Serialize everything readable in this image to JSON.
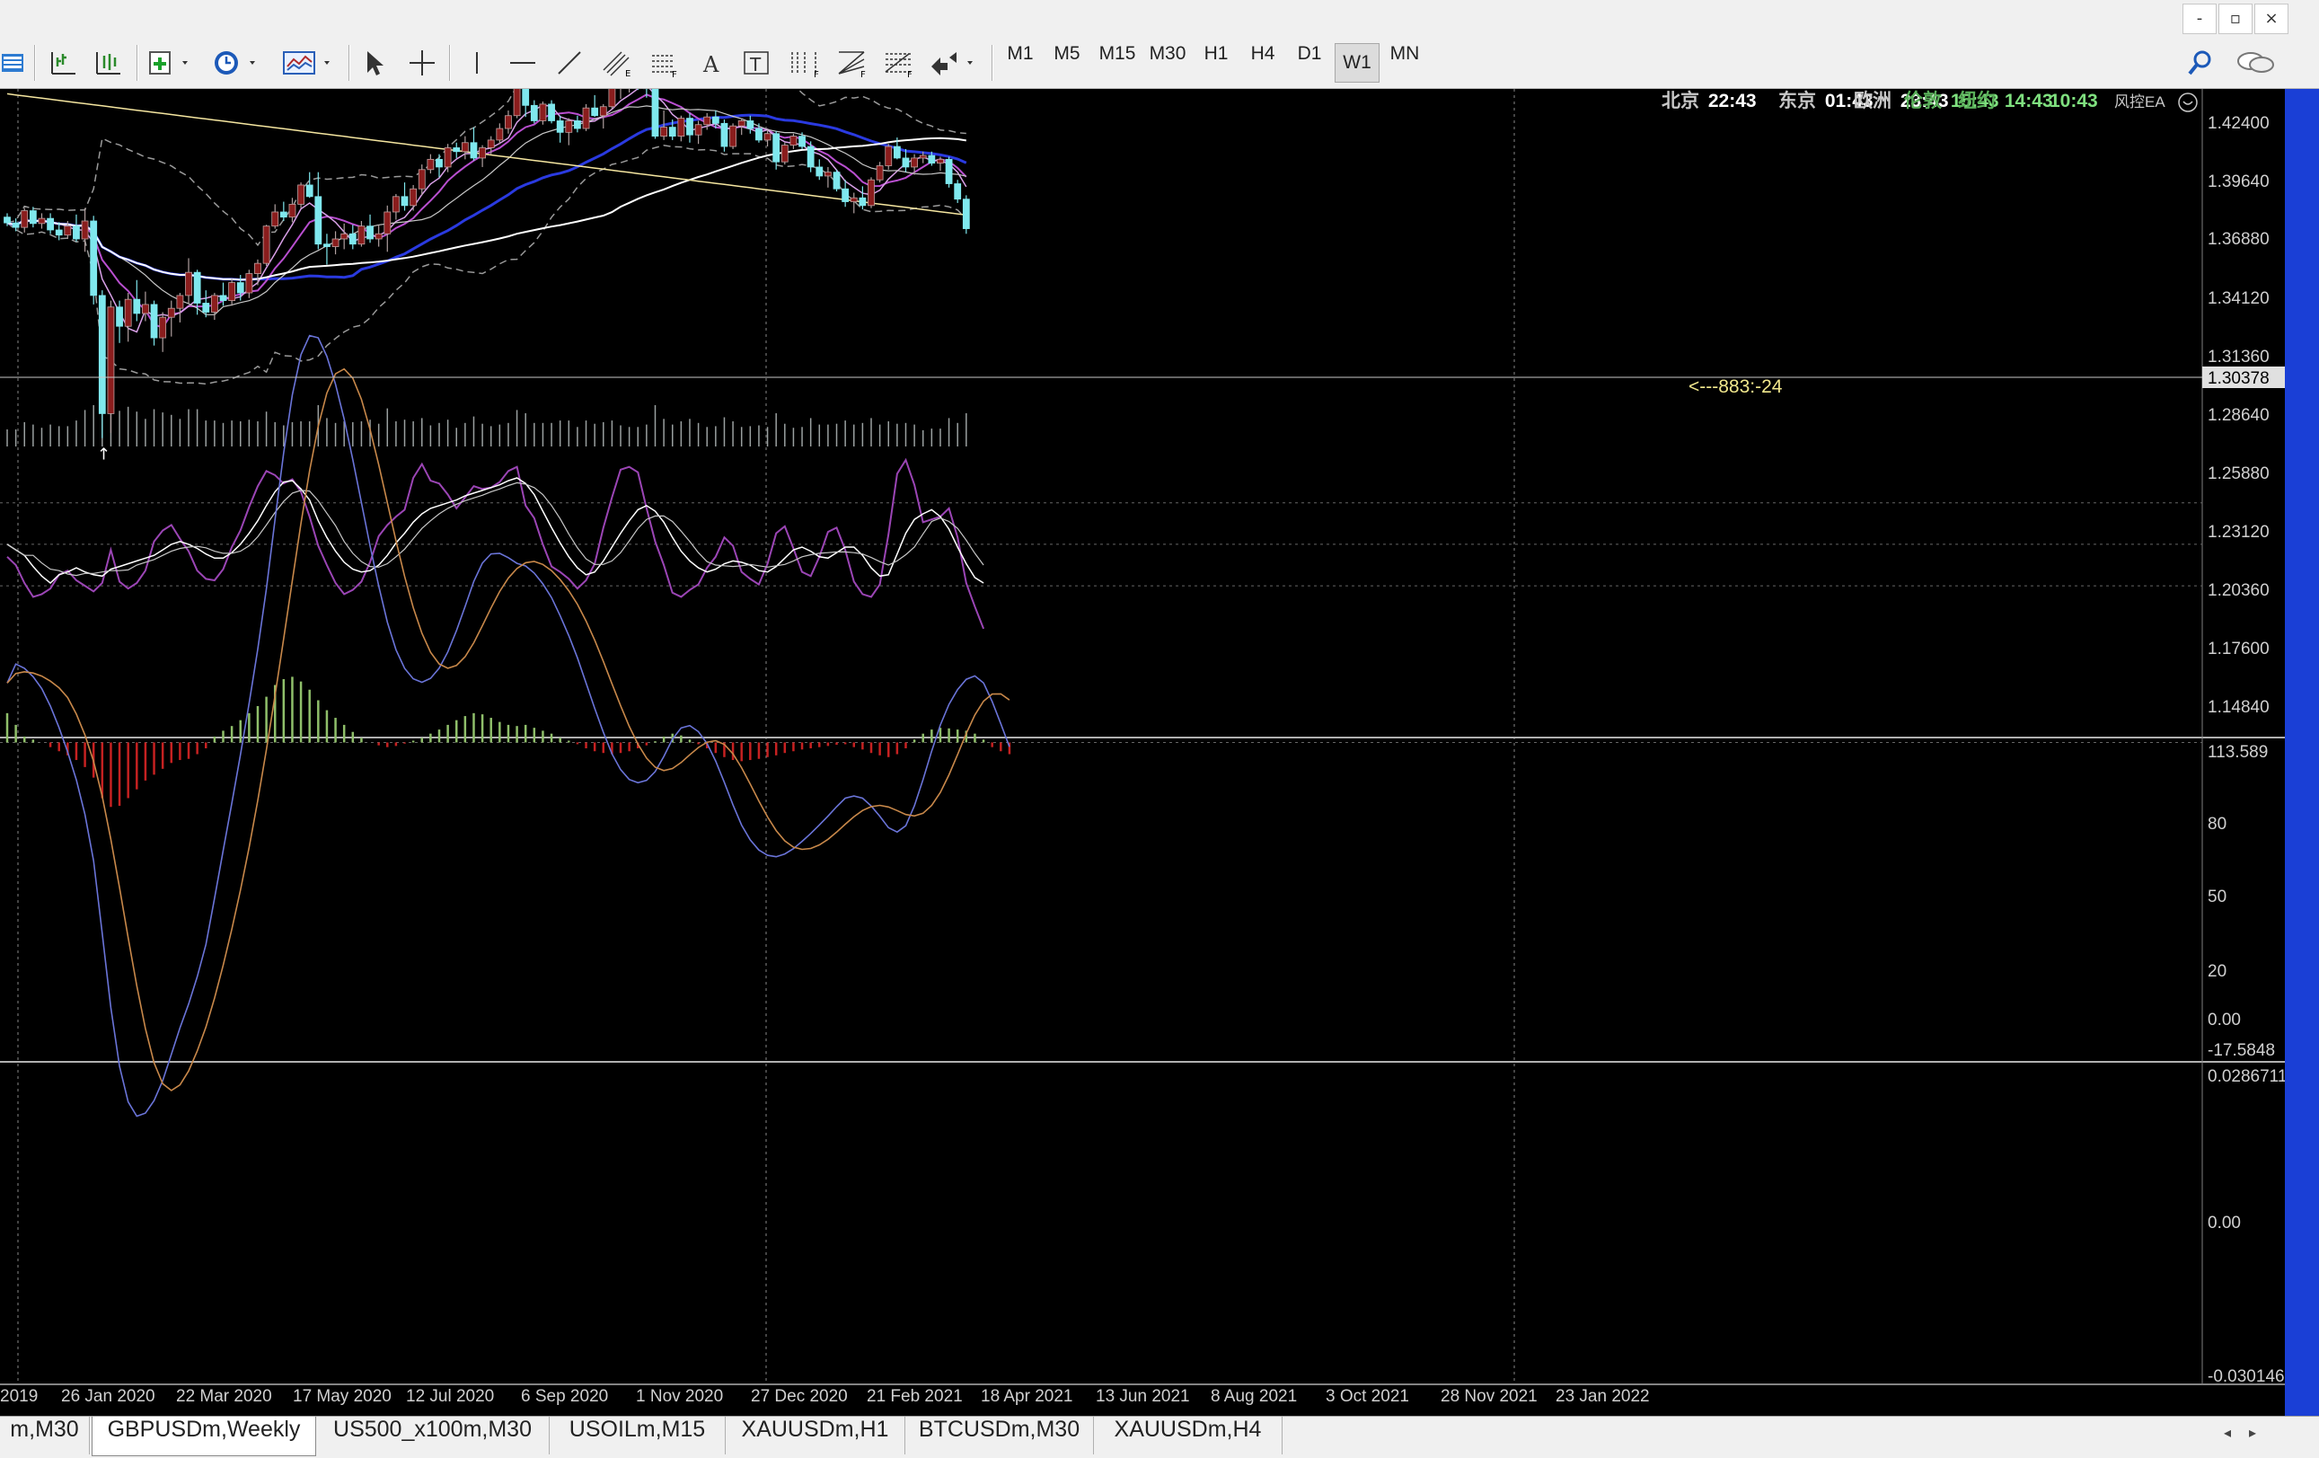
{
  "window": {
    "minimize": "-",
    "restore": "▫",
    "close": "×"
  },
  "toolbar": {
    "timeframes": [
      "M1",
      "M5",
      "M15",
      "M30",
      "H1",
      "H4",
      "D1",
      "W1",
      "MN"
    ],
    "active_timeframe": "W1"
  },
  "world_clock": [
    {
      "city": "北京",
      "time": "22:43"
    },
    {
      "city": "东京",
      "time": "01:43"
    },
    {
      "city": "欧洲",
      "time": "23:43"
    },
    {
      "city": "伦敦",
      "time": "15:43"
    },
    {
      "city": "纽约",
      "time": "14:43"
    },
    {
      "city": "",
      "time": "10:43"
    }
  ],
  "ea_label": "风控EA",
  "price_axis": [
    "1.42400",
    "1.39640",
    "1.36880",
    "1.34120",
    "1.31360",
    "1.28640",
    "1.25880",
    "1.23120",
    "1.20360",
    "1.17600",
    "1.14840"
  ],
  "current_price": "1.30378",
  "annotation": "<---883:-24",
  "stoch_axis": [
    "113.589",
    "80",
    "50",
    "20",
    "0.00",
    "-17.5848"
  ],
  "macd_axis": [
    "0.0286711",
    "0.00",
    "-0.0301467"
  ],
  "date_axis": [
    "2019",
    "26 Jan 2020",
    "22 Mar 2020",
    "17 May 2020",
    "12 Jul 2020",
    "6 Sep 2020",
    "1 Nov 2020",
    "27 Dec 2020",
    "21 Feb 2021",
    "18 Apr 2021",
    "13 Jun 2021",
    "8 Aug 2021",
    "3 Oct 2021",
    "28 Nov 2021",
    "23 Jan 2022"
  ],
  "tabs": [
    "m,M30",
    "GBPUSDm,Weekly",
    "US500_x100m,M30",
    "USOILm,M15",
    "XAUUSDm,H1",
    "BTCUSDm,M30",
    "XAUUSDm,H4"
  ],
  "active_tab": "GBPUSDm,Weekly",
  "colors": {
    "bull": "#8a1d1d",
    "bear": "#7fe8ee",
    "macd_up": "#8fbf6a",
    "macd_down": "#c62121",
    "stoch_main": "#9b45b5",
    "ma_slow": "#2a3ae0",
    "ma_long": "#f5e6a0"
  },
  "chart_data": {
    "type": "candlestick",
    "symbol": "GBPUSDm",
    "timeframe": "Weekly",
    "ohlc": [
      [
        1.313,
        1.316,
        1.306,
        1.3085
      ],
      [
        1.3085,
        1.312,
        1.302,
        1.305
      ],
      [
        1.305,
        1.32,
        1.301,
        1.318
      ],
      [
        1.318,
        1.321,
        1.305,
        1.308
      ],
      [
        1.308,
        1.316,
        1.304,
        1.312
      ],
      [
        1.312,
        1.316,
        1.3,
        1.303
      ],
      [
        1.303,
        1.309,
        1.295,
        1.299
      ],
      [
        1.299,
        1.31,
        1.296,
        1.306
      ],
      [
        1.306,
        1.315,
        1.294,
        1.296
      ],
      [
        1.296,
        1.32,
        1.286,
        1.31
      ],
      [
        1.31,
        1.314,
        1.245,
        1.252
      ],
      [
        1.252,
        1.256,
        1.141,
        1.16
      ],
      [
        1.16,
        1.248,
        1.145,
        1.243
      ],
      [
        1.243,
        1.248,
        1.215,
        1.228
      ],
      [
        1.228,
        1.254,
        1.216,
        1.249
      ],
      [
        1.249,
        1.264,
        1.232,
        1.238
      ],
      [
        1.238,
        1.255,
        1.232,
        1.245
      ],
      [
        1.245,
        1.248,
        1.213,
        1.219
      ],
      [
        1.219,
        1.239,
        1.208,
        1.235
      ],
      [
        1.235,
        1.248,
        1.22,
        1.242
      ],
      [
        1.242,
        1.254,
        1.231,
        1.252
      ],
      [
        1.252,
        1.281,
        1.246,
        1.27
      ],
      [
        1.27,
        1.272,
        1.237,
        1.246
      ],
      [
        1.246,
        1.256,
        1.235,
        1.239
      ],
      [
        1.239,
        1.254,
        1.233,
        1.252
      ],
      [
        1.252,
        1.262,
        1.244,
        1.248
      ],
      [
        1.248,
        1.265,
        1.244,
        1.262
      ],
      [
        1.262,
        1.268,
        1.248,
        1.254
      ],
      [
        1.254,
        1.272,
        1.25,
        1.269
      ],
      [
        1.269,
        1.28,
        1.26,
        1.277
      ],
      [
        1.277,
        1.307,
        1.275,
        1.306
      ],
      [
        1.306,
        1.323,
        1.304,
        1.317
      ],
      [
        1.317,
        1.325,
        1.31,
        1.313
      ],
      [
        1.313,
        1.328,
        1.309,
        1.323
      ],
      [
        1.323,
        1.34,
        1.32,
        1.338
      ],
      [
        1.338,
        1.348,
        1.328,
        1.329
      ],
      [
        1.329,
        1.348,
        1.288,
        1.292
      ],
      [
        1.292,
        1.3,
        1.276,
        1.29
      ],
      [
        1.29,
        1.302,
        1.284,
        1.296
      ],
      [
        1.296,
        1.308,
        1.288,
        1.3
      ],
      [
        1.3,
        1.307,
        1.288,
        1.292
      ],
      [
        1.292,
        1.31,
        1.29,
        1.306
      ],
      [
        1.306,
        1.315,
        1.293,
        1.296
      ],
      [
        1.296,
        1.307,
        1.29,
        1.3
      ],
      [
        1.3,
        1.322,
        1.286,
        1.317
      ],
      [
        1.317,
        1.331,
        1.311,
        1.329
      ],
      [
        1.329,
        1.34,
        1.318,
        1.322
      ],
      [
        1.322,
        1.338,
        1.318,
        1.335
      ],
      [
        1.335,
        1.354,
        1.33,
        1.35
      ],
      [
        1.35,
        1.362,
        1.347,
        1.358
      ],
      [
        1.358,
        1.362,
        1.344,
        1.352
      ],
      [
        1.352,
        1.37,
        1.348,
        1.367
      ],
      [
        1.367,
        1.371,
        1.359,
        1.364
      ],
      [
        1.364,
        1.376,
        1.358,
        1.371
      ],
      [
        1.371,
        1.383,
        1.357,
        1.359
      ],
      [
        1.359,
        1.369,
        1.352,
        1.367
      ],
      [
        1.367,
        1.376,
        1.362,
        1.373
      ],
      [
        1.373,
        1.386,
        1.37,
        1.382
      ],
      [
        1.382,
        1.396,
        1.378,
        1.392
      ],
      [
        1.392,
        1.424,
        1.39,
        1.42
      ],
      [
        1.42,
        1.421,
        1.391,
        1.4
      ],
      [
        1.4,
        1.404,
        1.386,
        1.388
      ],
      [
        1.388,
        1.403,
        1.385,
        1.401
      ],
      [
        1.401,
        1.404,
        1.386,
        1.388
      ],
      [
        1.388,
        1.392,
        1.371,
        1.379
      ],
      [
        1.379,
        1.39,
        1.369,
        1.388
      ],
      [
        1.388,
        1.392,
        1.379,
        1.382
      ],
      [
        1.382,
        1.401,
        1.38,
        1.398
      ],
      [
        1.398,
        1.408,
        1.391,
        1.392
      ],
      [
        1.392,
        1.401,
        1.382,
        1.399
      ],
      [
        1.399,
        1.418,
        1.397,
        1.414
      ],
      [
        1.414,
        1.42,
        1.405,
        1.415
      ],
      [
        1.415,
        1.423,
        1.41,
        1.42
      ],
      [
        1.42,
        1.425,
        1.412,
        1.417
      ],
      [
        1.417,
        1.422,
        1.406,
        1.413
      ],
      [
        1.413,
        1.416,
        1.374,
        1.376
      ],
      [
        1.376,
        1.396,
        1.373,
        1.383
      ],
      [
        1.383,
        1.389,
        1.373,
        1.376
      ],
      [
        1.376,
        1.392,
        1.372,
        1.39
      ],
      [
        1.39,
        1.394,
        1.371,
        1.377
      ],
      [
        1.377,
        1.388,
        1.37,
        1.385
      ],
      [
        1.385,
        1.394,
        1.381,
        1.391
      ],
      [
        1.391,
        1.396,
        1.382,
        1.386
      ],
      [
        1.386,
        1.389,
        1.364,
        1.368
      ],
      [
        1.368,
        1.386,
        1.366,
        1.384
      ],
      [
        1.384,
        1.39,
        1.377,
        1.388
      ],
      [
        1.388,
        1.392,
        1.378,
        1.382
      ],
      [
        1.382,
        1.386,
        1.371,
        1.373
      ],
      [
        1.373,
        1.381,
        1.368,
        1.378
      ],
      [
        1.378,
        1.38,
        1.35,
        1.356
      ],
      [
        1.356,
        1.371,
        1.354,
        1.369
      ],
      [
        1.369,
        1.378,
        1.366,
        1.376
      ],
      [
        1.376,
        1.379,
        1.366,
        1.368
      ],
      [
        1.368,
        1.372,
        1.348,
        1.352
      ],
      [
        1.352,
        1.358,
        1.342,
        1.345
      ],
      [
        1.345,
        1.352,
        1.336,
        1.348
      ],
      [
        1.348,
        1.35,
        1.333,
        1.335
      ],
      [
        1.335,
        1.342,
        1.321,
        1.325
      ],
      [
        1.325,
        1.332,
        1.316,
        1.328
      ],
      [
        1.328,
        1.337,
        1.319,
        1.322
      ],
      [
        1.322,
        1.344,
        1.32,
        1.342
      ],
      [
        1.342,
        1.356,
        1.34,
        1.353
      ],
      [
        1.353,
        1.37,
        1.35,
        1.368
      ],
      [
        1.368,
        1.375,
        1.358,
        1.359
      ],
      [
        1.359,
        1.366,
        1.348,
        1.352
      ],
      [
        1.352,
        1.362,
        1.346,
        1.359
      ],
      [
        1.359,
        1.364,
        1.355,
        1.361
      ],
      [
        1.361,
        1.364,
        1.353,
        1.355
      ],
      [
        1.355,
        1.36,
        1.349,
        1.358
      ],
      [
        1.358,
        1.36,
        1.336,
        1.339
      ],
      [
        1.339,
        1.342,
        1.324,
        1.327
      ],
      [
        1.327,
        1.33,
        1.3,
        1.304
      ]
    ],
    "stoch": {
      "main": [
        41,
        35,
        22,
        12,
        14,
        18,
        28,
        31,
        24,
        20,
        16,
        22,
        46,
        23,
        18,
        22,
        31,
        52,
        60,
        64,
        54,
        45,
        31,
        25,
        24,
        32,
        48,
        60,
        77,
        92,
        103,
        100,
        94,
        97,
        88,
        70,
        49,
        35,
        22,
        14,
        17,
        23,
        37,
        56,
        64,
        70,
        75,
        98,
        108,
        96,
        94,
        86,
        76,
        84,
        92,
        90,
        91,
        95,
        103,
        106,
        78,
        69,
        50,
        34,
        30,
        25,
        18,
        24,
        36,
        62,
        84,
        104,
        106,
        102,
        76,
        52,
        35,
        15,
        12,
        17,
        21,
        33,
        41,
        55,
        49,
        30,
        25,
        21,
        36,
        58,
        63,
        47,
        30,
        27,
        41,
        59,
        62,
        46,
        23,
        14,
        12,
        21,
        57,
        101,
        111,
        93,
        66,
        68,
        70,
        76,
        55,
        22,
        5,
        -11
      ],
      "signal": [
        50,
        46,
        42,
        34,
        27,
        22,
        28,
        30,
        33,
        30,
        28,
        27,
        32,
        34,
        36,
        38,
        40,
        42,
        46,
        50,
        52,
        50,
        47,
        43,
        40,
        40,
        44,
        50,
        58,
        67,
        78,
        88,
        95,
        96,
        90,
        82,
        67,
        55,
        45,
        37,
        32,
        30,
        31,
        35,
        42,
        51,
        58,
        66,
        72,
        76,
        78,
        80,
        82,
        85,
        87,
        89,
        91,
        93,
        96,
        98,
        94,
        86,
        74,
        62,
        51,
        41,
        33,
        28,
        30,
        38,
        48,
        58,
        67,
        75,
        78,
        74,
        66,
        55,
        45,
        38,
        33,
        30,
        32,
        36,
        38,
        37,
        35,
        31,
        30,
        34,
        40,
        46,
        48,
        45,
        41,
        40,
        44,
        48,
        48,
        42,
        33,
        27,
        28,
        43,
        58,
        68,
        72,
        75,
        70,
        61,
        48,
        36,
        26,
        22
      ]
    },
    "macd": {
      "histogram": [
        0.005,
        0.003,
        0.001,
        0.0005,
        0,
        -0.0008,
        -0.0015,
        -0.0022,
        -0.003,
        -0.0042,
        -0.006,
        -0.0095,
        -0.011,
        -0.0108,
        -0.0095,
        -0.008,
        -0.0065,
        -0.0055,
        -0.0045,
        -0.0035,
        -0.003,
        -0.0028,
        -0.002,
        -0.001,
        0.001,
        0.002,
        0.0028,
        0.0038,
        0.005,
        0.0062,
        0.0078,
        0.0098,
        0.0108,
        0.0112,
        0.0104,
        0.009,
        0.0072,
        0.0055,
        0.0042,
        0.003,
        0.0018,
        0.0008,
        0,
        -0.0005,
        -0.0008,
        -0.0006,
        -0.0002,
        0.0003,
        0.0008,
        0.0015,
        0.0022,
        0.003,
        0.0038,
        0.0045,
        0.005,
        0.0048,
        0.0042,
        0.0035,
        0.003,
        0.0028,
        0.003,
        0.0025,
        0.002,
        0.0015,
        0.0008,
        0.0003,
        -0.0003,
        -0.001,
        -0.0015,
        -0.0018,
        -0.002,
        -0.0018,
        -0.0015,
        -0.001,
        -0.0005,
        0.0002,
        0.001,
        0.0015,
        0.0012,
        0.0005,
        -0.0003,
        -0.001,
        -0.0018,
        -0.0025,
        -0.003,
        -0.0032,
        -0.003,
        -0.0028,
        -0.0025,
        -0.0022,
        -0.0018,
        -0.0015,
        -0.0012,
        -0.001,
        -0.0008,
        -0.0006,
        -0.0004,
        -0.0003,
        -0.0008,
        -0.0012,
        -0.0018,
        -0.0022,
        -0.0025,
        -0.002,
        -0.001,
        0.0005,
        0.0015,
        0.0022,
        0.0025,
        0.0024,
        0.0022,
        0.002,
        0.0015,
        0.0005,
        -0.0008,
        -0.0015,
        -0.002
      ]
    }
  }
}
